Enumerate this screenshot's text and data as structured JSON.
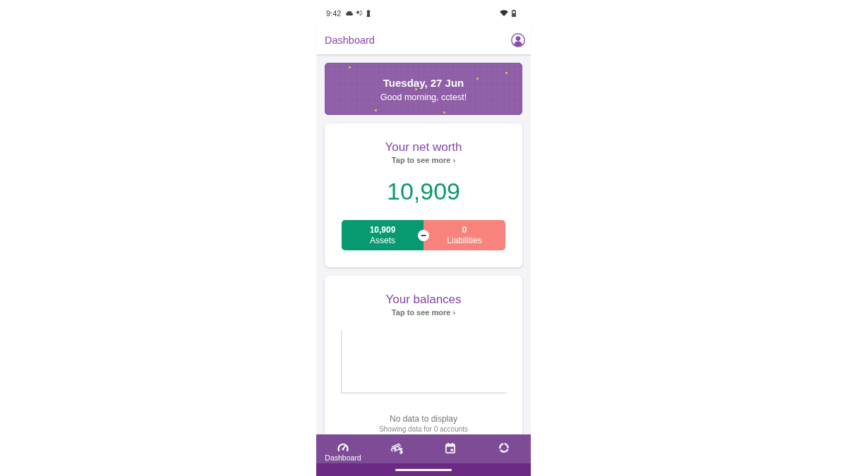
{
  "status_bar": {
    "time": "9:42"
  },
  "app_bar": {
    "title": "Dashboard"
  },
  "greeting_banner": {
    "date": "Tuesday, 27 Jun",
    "greeting": "Good morning, cctest!"
  },
  "net_worth_card": {
    "title": "Your net worth",
    "link": "Tap to see more ›",
    "total": "10,909",
    "assets": {
      "value": "10,909",
      "label": "Assets"
    },
    "liabilities": {
      "value": "0",
      "label": "Liabilities"
    }
  },
  "balances_card": {
    "title": "Your balances",
    "link": "Tap to see more ›",
    "empty_message": "No data to display",
    "footnote": "Showing data for 0 accounts"
  },
  "bottom_nav": [
    {
      "kind": "dashboard",
      "label": "Dashboard",
      "selected": true
    },
    {
      "kind": "transactions",
      "selected": false
    },
    {
      "kind": "calendar",
      "selected": false
    },
    {
      "kind": "budgets",
      "selected": false
    }
  ]
}
